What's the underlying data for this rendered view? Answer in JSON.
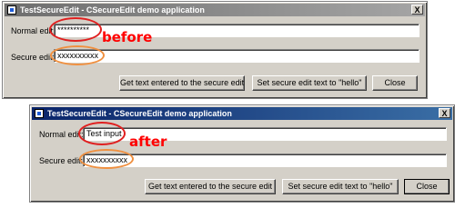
{
  "window_before": {
    "title": "TestSecureEdit - CSecureEdit demo application",
    "close_glyph": "X",
    "normal_label": "Normal edit:",
    "normal_value": "**********",
    "secure_label": "Secure edit:",
    "secure_value": "xxxxxxxxxx",
    "btn_get": "Get text entered to the secure edit",
    "btn_set": "Set secure edit text to \"hello\"",
    "btn_close": "Close"
  },
  "window_after": {
    "title": "TestSecureEdit - CSecureEdit demo application",
    "close_glyph": "X",
    "normal_label": "Normal edit:",
    "normal_value": "Test input",
    "secure_label": "Secure edit:",
    "secure_value": "xxxxxxxxxx",
    "btn_get": "Get text entered to the secure edit",
    "btn_set": "Set secure edit text to \"hello\"",
    "btn_close": "Close"
  },
  "annotations": {
    "before": "before",
    "after": "after",
    "color": "#ff0000"
  }
}
